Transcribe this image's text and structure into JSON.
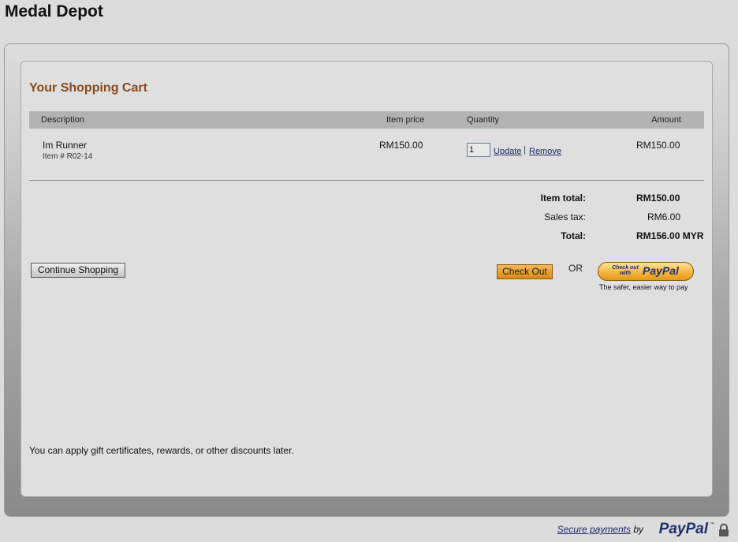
{
  "site": {
    "title": "Medal Depot"
  },
  "cart": {
    "heading": "Your Shopping Cart",
    "columns": {
      "description": "Description",
      "item_price": "Item price",
      "quantity": "Quantity",
      "amount": "Amount"
    },
    "items": [
      {
        "name": "Im Runner",
        "item_number": "Item # R02-14",
        "price": "RM150.00",
        "quantity": "1",
        "amount": "RM150.00"
      }
    ],
    "update_label": "Update",
    "separator": "|",
    "remove_label": "Remove"
  },
  "summary": {
    "item_total_label": "Item total:",
    "item_total_value": "RM150.00",
    "sales_tax_label": "Sales tax:",
    "sales_tax_value": "RM6.00",
    "total_label": "Total:",
    "total_value": "RM156.00 MYR"
  },
  "actions": {
    "continue_label": "Continue Shopping",
    "checkout_label": "Check Out",
    "or_label": "OR",
    "paypal_button_small": "Check out with",
    "paypal_button_logo": "PayPal",
    "paypal_tagline": "The safer, easier way to pay"
  },
  "notes": {
    "discount": "You can apply gift certificates, rewards, or other discounts later."
  },
  "footer": {
    "secure_label": "Secure payments",
    "by_label": "by",
    "logo": "PayPal",
    "trademark": "™"
  },
  "colors": {
    "heading": "#8a4a1c",
    "checkout_button": "#e39a1c",
    "paypal_blue": "#1e2f6b",
    "link": "#1a2a66"
  },
  "icons": {
    "lock": "lock-icon"
  }
}
